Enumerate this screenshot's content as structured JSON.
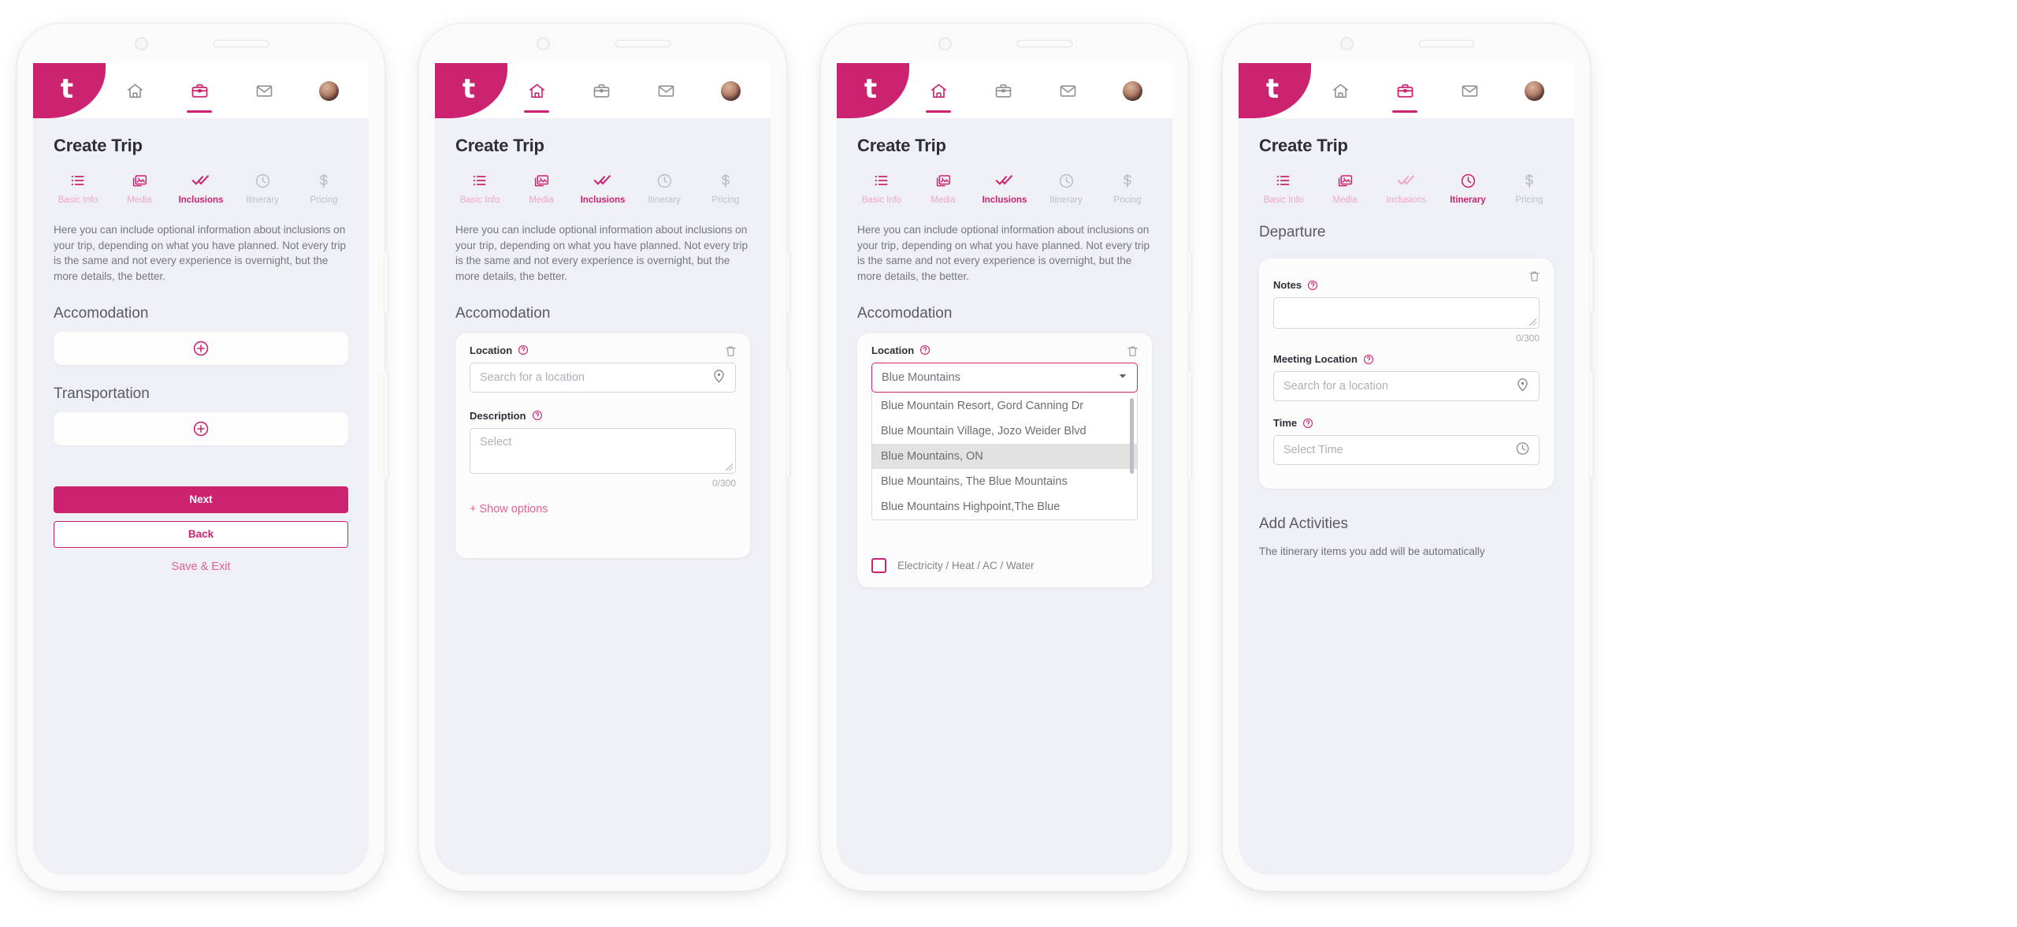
{
  "brand": {
    "pink": "#CC2370",
    "pink_light": "#e06396",
    "pink_pale": "#f1a7c4",
    "screen_bg": "#eff0f5"
  },
  "app": {
    "logo_letter": "t",
    "nav": [
      {
        "name": "home-icon",
        "label": "Home"
      },
      {
        "name": "briefcase-icon",
        "label": "Trips"
      },
      {
        "name": "mail-icon",
        "label": "Messages"
      },
      {
        "name": "avatar",
        "label": "Profile"
      }
    ]
  },
  "page_title": "Create Trip",
  "steps": [
    {
      "label": "Basic Info",
      "icon": "list-icon"
    },
    {
      "label": "Media",
      "icon": "images-icon"
    },
    {
      "label": "Inclusions",
      "icon": "double-check-icon"
    },
    {
      "label": "Itinerary",
      "icon": "clock-icon"
    },
    {
      "label": "Pricing",
      "icon": "dollar-icon"
    }
  ],
  "intro_text": "Here you can include optional information about inclusions on your trip, depending on what you have planned. Not every trip is the same and not every experience is overnight, but the more details, the better.",
  "sections": {
    "accomodation": "Accomodation",
    "transportation": "Transportation",
    "departure": "Departure",
    "add_activities": "Add Activities"
  },
  "buttons": {
    "next": "Next",
    "back": "Back",
    "save_exit": "Save & Exit",
    "show_options": "+ Show options"
  },
  "fields": {
    "location_label": "Location",
    "location_placeholder": "Search for a location",
    "location_value": "Blue Mountains",
    "description_label": "Description",
    "description_placeholder": "Select",
    "notes_label": "Notes",
    "meeting_location_label": "Meeting Location",
    "meeting_location_placeholder": "Search for a location",
    "time_label": "Time",
    "time_placeholder": "Select Time",
    "counter": "0/300"
  },
  "dropdown_options": [
    "Blue Mountain Resort, Gord Canning Dr",
    "Blue Mountain Village, Jozo Weider Blvd",
    "Blue Mountains, ON",
    "Blue Mountains, The Blue Mountains",
    "Blue Mountains Highpoint,The Blue"
  ],
  "dropdown_highlighted_index": 2,
  "checkbox": {
    "label": "Electricity / Heat / AC / Water",
    "checked": false
  },
  "activities_note": "The itinerary items you add will be automatically",
  "phones": [
    {
      "active_nav": 1,
      "active_step": 2
    },
    {
      "active_nav": 0,
      "active_step": 2
    },
    {
      "active_nav": 0,
      "active_step": 2
    },
    {
      "active_nav": 1,
      "active_step": 3
    }
  ]
}
